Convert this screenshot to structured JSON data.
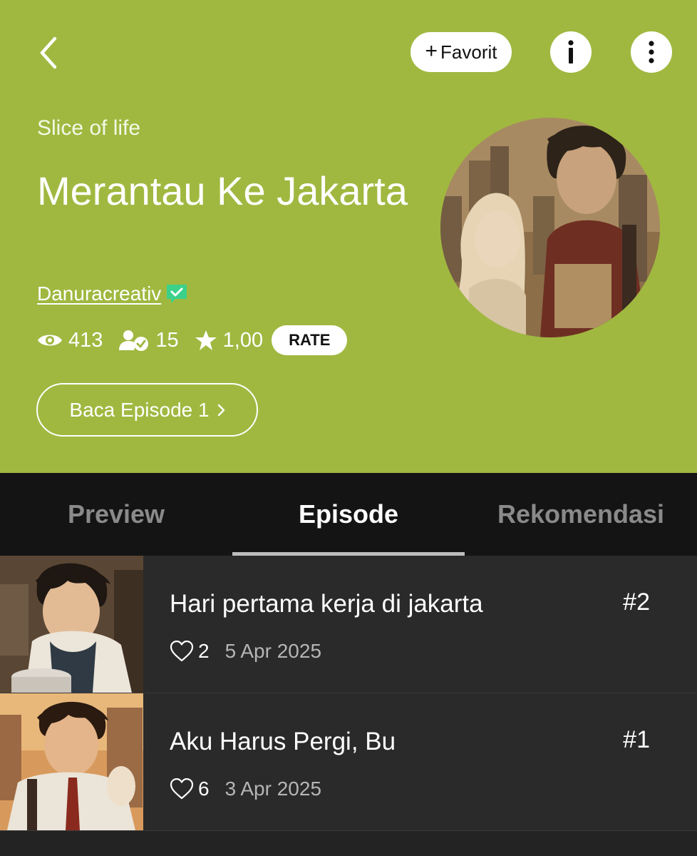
{
  "header": {
    "favorite_label": "Favorit",
    "genre": "Slice of life",
    "title": "Merantau Ke Jakarta",
    "author": "Danuracreativ",
    "stats": {
      "views": "413",
      "subscribers": "15",
      "rating": "1,00"
    },
    "rate_label": "RATE",
    "read_label": "Baca Episode 1",
    "bg_color": "#a0b840"
  },
  "tabs": [
    {
      "label": "Preview",
      "active": false
    },
    {
      "label": "Episode",
      "active": true
    },
    {
      "label": "Rekomendasi",
      "active": false
    }
  ],
  "episodes": [
    {
      "title": "Hari pertama kerja di jakarta",
      "number": "#2",
      "likes": "2",
      "date": "5 Apr 2025"
    },
    {
      "title": "Aku Harus Pergi, Bu",
      "number": "#1",
      "likes": "6",
      "date": "3 Apr 2025"
    }
  ],
  "icons": [
    "back-icon",
    "plus-icon",
    "info-icon",
    "more-vertical-icon",
    "verified-icon",
    "eye-icon",
    "subscribers-icon",
    "star-icon",
    "chevron-right-icon",
    "heart-icon"
  ]
}
